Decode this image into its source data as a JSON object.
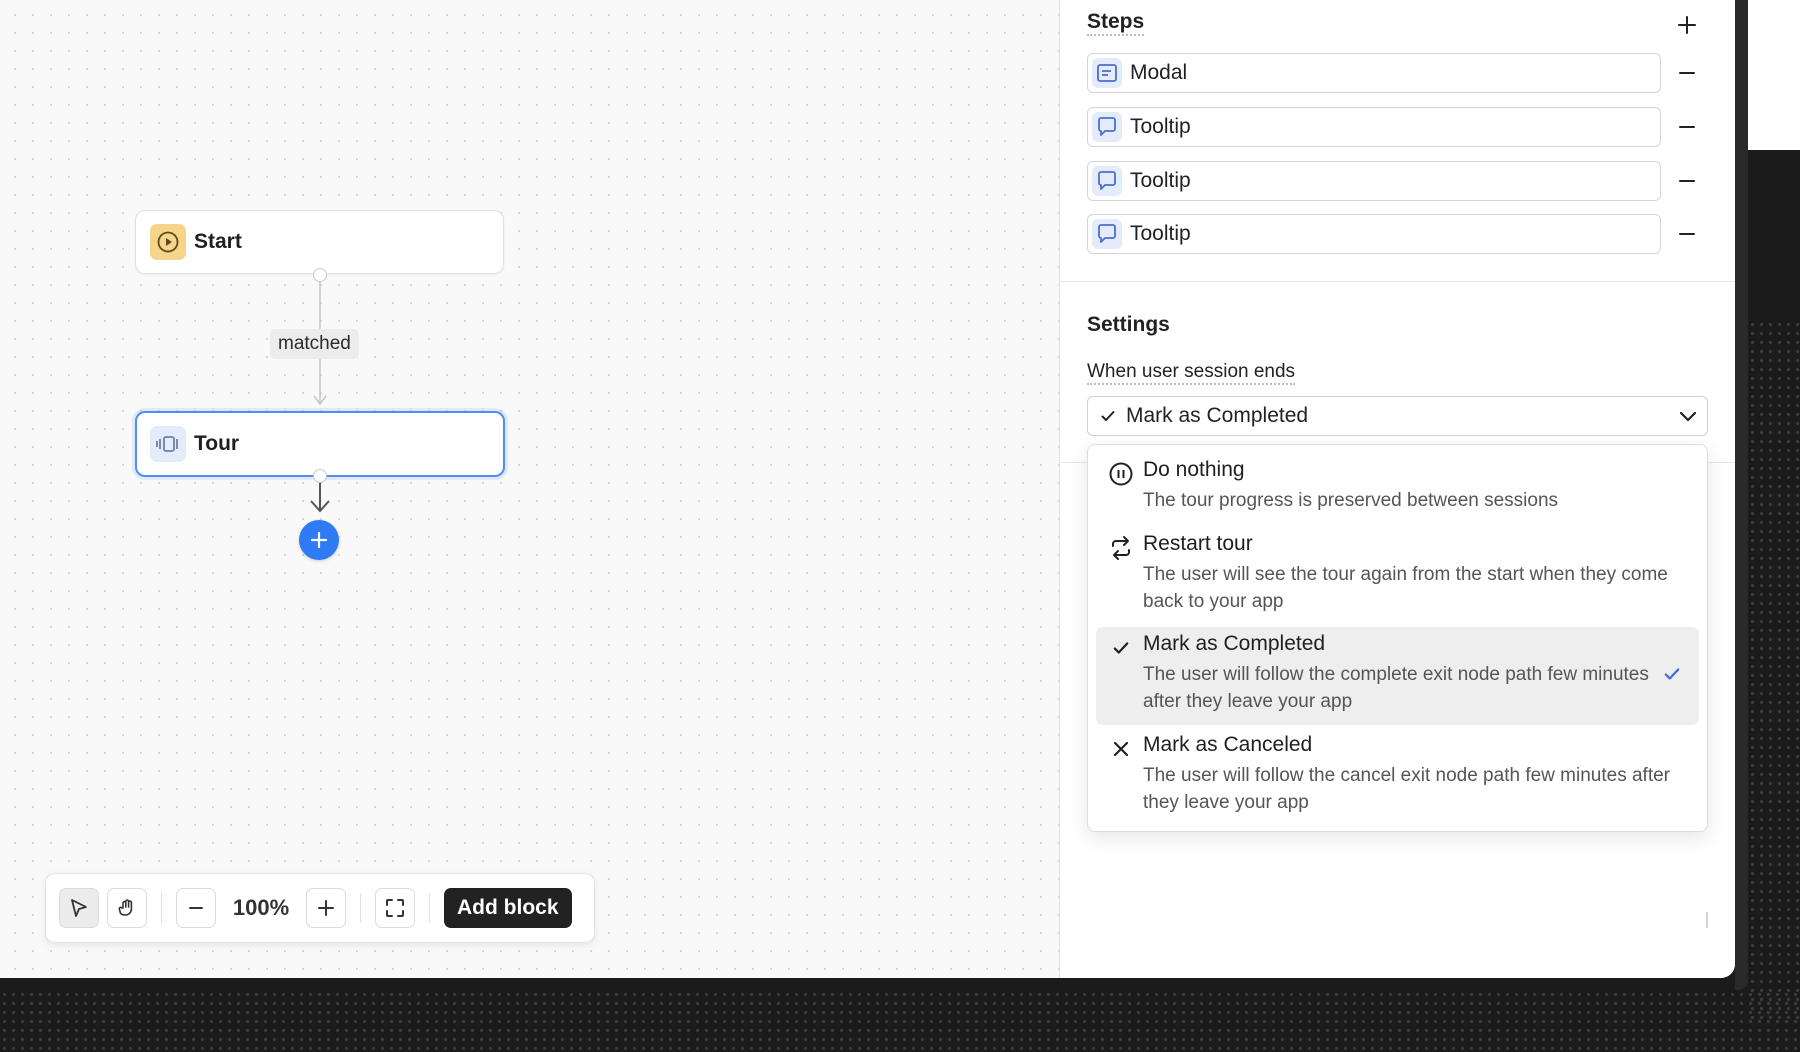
{
  "canvas": {
    "nodes": {
      "start": {
        "label": "Start",
        "icon": "play-circle-icon"
      },
      "tour": {
        "label": "Tour",
        "icon": "tour-carousel-icon"
      }
    },
    "edge_label": "matched",
    "add_node_icon": "plus-icon"
  },
  "toolbar": {
    "zoom": "100%",
    "add_block_label": "Add block",
    "tools": [
      "pointer-icon",
      "hand-icon",
      "zoom-out-icon",
      "zoom-in-icon",
      "fit-view-icon"
    ]
  },
  "panel": {
    "steps_title": "Steps",
    "steps": [
      {
        "label": "Modal",
        "icon": "modal-icon"
      },
      {
        "label": "Tooltip",
        "icon": "tooltip-icon"
      },
      {
        "label": "Tooltip",
        "icon": "tooltip-icon"
      },
      {
        "label": "Tooltip",
        "icon": "tooltip-icon"
      }
    ],
    "settings_title": "Settings",
    "session_end_label": "When user session ends",
    "session_end_value": "Mark as Completed",
    "options": [
      {
        "title": "Do nothing",
        "desc": "The tour progress is preserved between sessions",
        "icon": "pause-circle-icon"
      },
      {
        "title": "Restart tour",
        "desc": "The user will see the tour again from the start when they come back to your app",
        "icon": "restart-icon"
      },
      {
        "title": "Mark as Completed",
        "desc": "The user will follow the complete exit node path few minutes after they leave your app",
        "icon": "check-icon",
        "selected": true
      },
      {
        "title": "Mark as Canceled",
        "desc": "The user will follow the cancel exit node path few minutes after they leave your app",
        "icon": "x-icon"
      }
    ]
  },
  "colors": {
    "accent": "#2f7bf5",
    "start_node": "#f6d58a",
    "step_icon_bg": "#e4ecfb"
  }
}
